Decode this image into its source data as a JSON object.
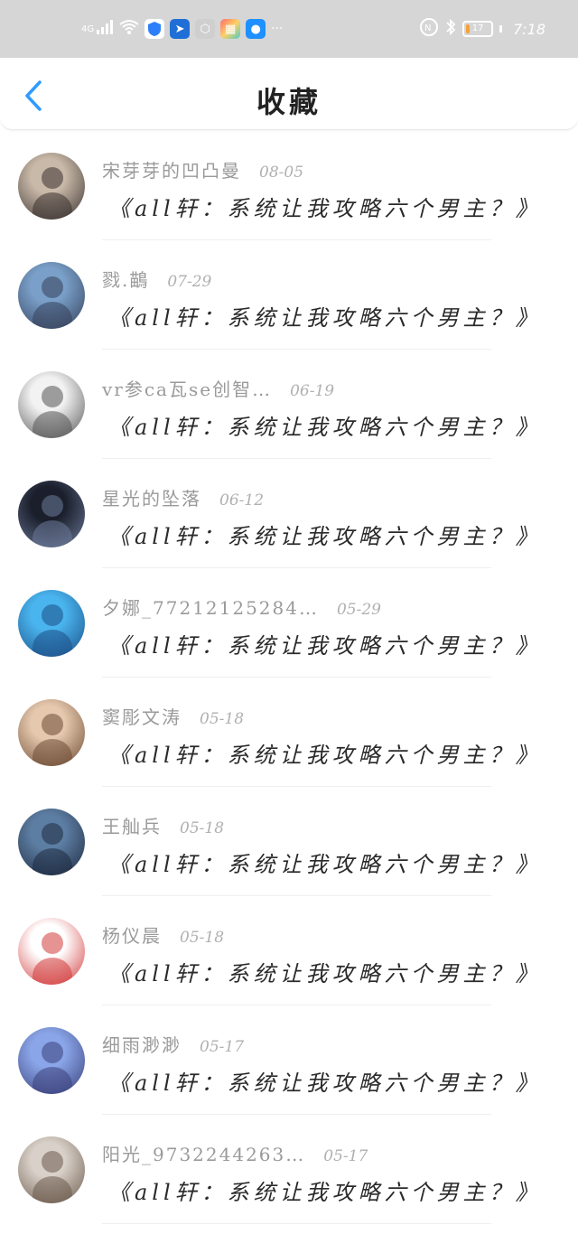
{
  "status_bar": {
    "network": "4G",
    "time": "7:18",
    "battery_level": "17",
    "battery_fraction": 0.17,
    "more_text": "···",
    "icons": [
      "signal-icon",
      "wifi-icon",
      "shield-app-icon",
      "pin-app-icon",
      "hex-app-icon",
      "grid-app-icon",
      "bird-app-icon",
      "nfc-icon",
      "bluetooth-icon",
      "battery-icon"
    ]
  },
  "header": {
    "title": "收藏",
    "back_icon": "chevron-left-icon",
    "accent_color": "#2f9bff"
  },
  "favorites": [
    {
      "name": "宋芽芽的凹凸曼",
      "date": "08-05",
      "title": "《all轩：系统让我攻略六个男主？》",
      "avatar_colors": [
        "#c9b9a8",
        "#3a3230"
      ]
    },
    {
      "name": "戮.鶓",
      "date": "07-29",
      "title": "《all轩：系统让我攻略六个男主？》",
      "avatar_colors": [
        "#7aa0c9",
        "#34405a"
      ]
    },
    {
      "name": "vr参ca瓦se创智…",
      "date": "06-19",
      "title": "《all轩：系统让我攻略六个男主？》",
      "avatar_colors": [
        "#f2f2f2",
        "#555555"
      ]
    },
    {
      "name": "星光的坠落",
      "date": "06-12",
      "title": "《all轩：系统让我攻略六个男主？》",
      "avatar_colors": [
        "#1b1f2c",
        "#6b7a99"
      ]
    },
    {
      "name": "夕娜_7721212528​4…",
      "date": "05-29",
      "title": "《all轩：系统让我攻略六个男主？》",
      "avatar_colors": [
        "#4ab4ee",
        "#1b4e86"
      ]
    },
    {
      "name": "窦彫文涛",
      "date": "05-18",
      "title": "《all轩：系统让我攻略六个男主？》",
      "avatar_colors": [
        "#e5c8ad",
        "#6d4b34"
      ]
    },
    {
      "name": "王舢兵",
      "date": "05-18",
      "title": "《all轩：系统让我攻略六个男主？》",
      "avatar_colors": [
        "#5d7ea3",
        "#1e2a3f"
      ]
    },
    {
      "name": "杨仪晨",
      "date": "05-18",
      "title": "《all轩：系统让我攻略六个男主？》",
      "avatar_colors": [
        "#ffffff",
        "#d23a3a"
      ]
    },
    {
      "name": "细雨渺渺",
      "date": "05-17",
      "title": "《all轩：系统让我攻略六个男主？》",
      "avatar_colors": [
        "#8aa6e8",
        "#3a3f7a"
      ]
    },
    {
      "name": "阳光_9732244263…",
      "date": "05-17",
      "title": "《all轩：系统让我攻略六个男主？》",
      "avatar_colors": [
        "#d9d1c9",
        "#6b5a4c"
      ]
    }
  ]
}
